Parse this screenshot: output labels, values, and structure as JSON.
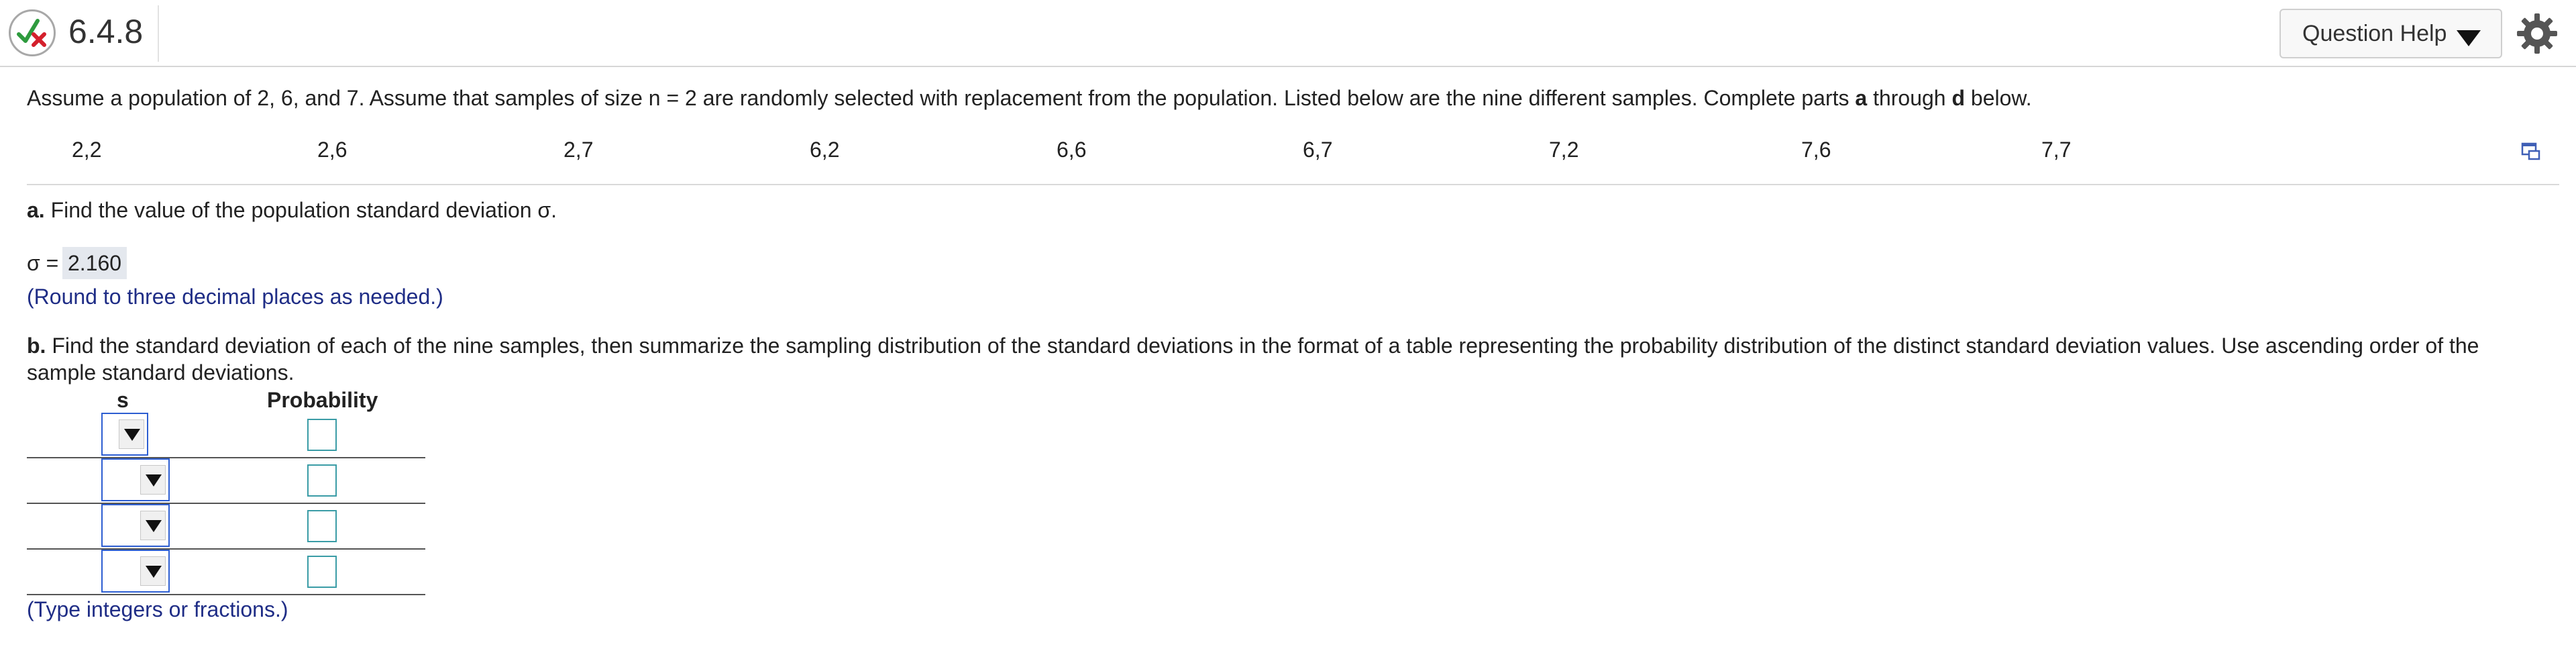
{
  "header": {
    "question_number": "6.4.8",
    "help_label": "Question Help"
  },
  "colors": {
    "accent_blue": "#1f2d86",
    "select_border": "#2d5ed1",
    "input_border": "#3a9ca6",
    "check_green": "#2e9b3e",
    "cross_red": "#d4202c"
  },
  "icons": {
    "status": "partial-check-cross-icon",
    "help_dropdown": "triangle-down-icon",
    "settings": "gear-icon",
    "expand": "expand-window-icon"
  },
  "intro": {
    "part1": "Assume a population of 2, 6, and 7. Assume that samples of size n = 2 are randomly selected with replacement from the population. Listed below are the nine different samples. Complete parts ",
    "a": "a",
    "through": " through ",
    "d": "d",
    "below": " below."
  },
  "samples": [
    "2,2",
    "2,6",
    "2,7",
    "6,2",
    "6,6",
    "6,7",
    "7,2",
    "7,6",
    "7,7"
  ],
  "part_a": {
    "letter": "a.",
    "prompt": " Find the value of the population standard deviation σ.",
    "answer_label": "σ =",
    "answer_value": "2.160",
    "hint": "(Round to three decimal places as needed.)"
  },
  "part_b": {
    "letter": "b.",
    "prompt_line1": " Find the standard deviation of each of the nine samples, then summarize the sampling distribution of the standard deviations in the format of a table representing the probability distribution of the distinct standard deviation values. Use ascending order of the",
    "prompt_line2": "sample standard deviations.",
    "col_s": "s",
    "col_prob": "Probability",
    "hint": "(Type integers or fractions.)"
  }
}
